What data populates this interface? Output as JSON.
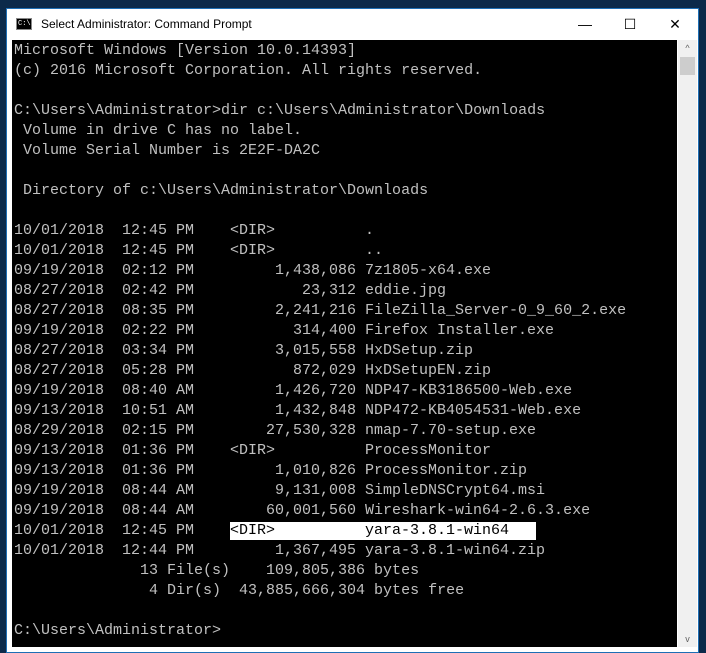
{
  "window": {
    "title": "Select Administrator: Command Prompt",
    "icon_text": "C:\\."
  },
  "controls": {
    "minimize": "—",
    "maximize": "☐",
    "close": "✕"
  },
  "header_lines": [
    "Microsoft Windows [Version 10.0.14393]",
    "(c) 2016 Microsoft Corporation. All rights reserved.",
    "",
    "C:\\Users\\Administrator>dir c:\\Users\\Administrator\\Downloads",
    " Volume in drive C has no label.",
    " Volume Serial Number is 2E2F-DA2C",
    "",
    " Directory of c:\\Users\\Administrator\\Downloads",
    ""
  ],
  "entries": [
    {
      "date": "10/01/2018",
      "time": "12:45 PM",
      "dir": "<DIR>",
      "size": "",
      "name": "."
    },
    {
      "date": "10/01/2018",
      "time": "12:45 PM",
      "dir": "<DIR>",
      "size": "",
      "name": ".."
    },
    {
      "date": "09/19/2018",
      "time": "02:12 PM",
      "dir": "",
      "size": "1,438,086",
      "name": "7z1805-x64.exe"
    },
    {
      "date": "08/27/2018",
      "time": "02:42 PM",
      "dir": "",
      "size": "23,312",
      "name": "eddie.jpg"
    },
    {
      "date": "08/27/2018",
      "time": "08:35 PM",
      "dir": "",
      "size": "2,241,216",
      "name": "FileZilla_Server-0_9_60_2.exe"
    },
    {
      "date": "09/19/2018",
      "time": "02:22 PM",
      "dir": "",
      "size": "314,400",
      "name": "Firefox Installer.exe"
    },
    {
      "date": "08/27/2018",
      "time": "03:34 PM",
      "dir": "",
      "size": "3,015,558",
      "name": "HxDSetup.zip"
    },
    {
      "date": "08/27/2018",
      "time": "05:28 PM",
      "dir": "",
      "size": "872,029",
      "name": "HxDSetupEN.zip"
    },
    {
      "date": "09/19/2018",
      "time": "08:40 AM",
      "dir": "",
      "size": "1,426,720",
      "name": "NDP47-KB3186500-Web.exe"
    },
    {
      "date": "09/13/2018",
      "time": "10:51 AM",
      "dir": "",
      "size": "1,432,848",
      "name": "NDP472-KB4054531-Web.exe"
    },
    {
      "date": "08/29/2018",
      "time": "02:15 PM",
      "dir": "",
      "size": "27,530,328",
      "name": "nmap-7.70-setup.exe"
    },
    {
      "date": "09/13/2018",
      "time": "01:36 PM",
      "dir": "<DIR>",
      "size": "",
      "name": "ProcessMonitor"
    },
    {
      "date": "09/13/2018",
      "time": "01:36 PM",
      "dir": "",
      "size": "1,010,826",
      "name": "ProcessMonitor.zip"
    },
    {
      "date": "09/19/2018",
      "time": "08:44 AM",
      "dir": "",
      "size": "9,131,008",
      "name": "SimpleDNSCrypt64.msi"
    },
    {
      "date": "09/19/2018",
      "time": "08:44 AM",
      "dir": "",
      "size": "60,001,560",
      "name": "Wireshark-win64-2.6.3.exe"
    },
    {
      "date": "10/01/2018",
      "time": "12:45 PM",
      "dir": "<DIR>",
      "size": "",
      "name": "yara-3.8.1-win64",
      "selected": true
    },
    {
      "date": "10/01/2018",
      "time": "12:44 PM",
      "dir": "",
      "size": "1,367,495",
      "name": "yara-3.8.1-win64.zip"
    }
  ],
  "footer_lines": [
    "              13 File(s)    109,805,386 bytes",
    "               4 Dir(s)  43,885,666,304 bytes free",
    "",
    "C:\\Users\\Administrator>"
  ],
  "scroll": {
    "up": "^",
    "down": "v"
  }
}
